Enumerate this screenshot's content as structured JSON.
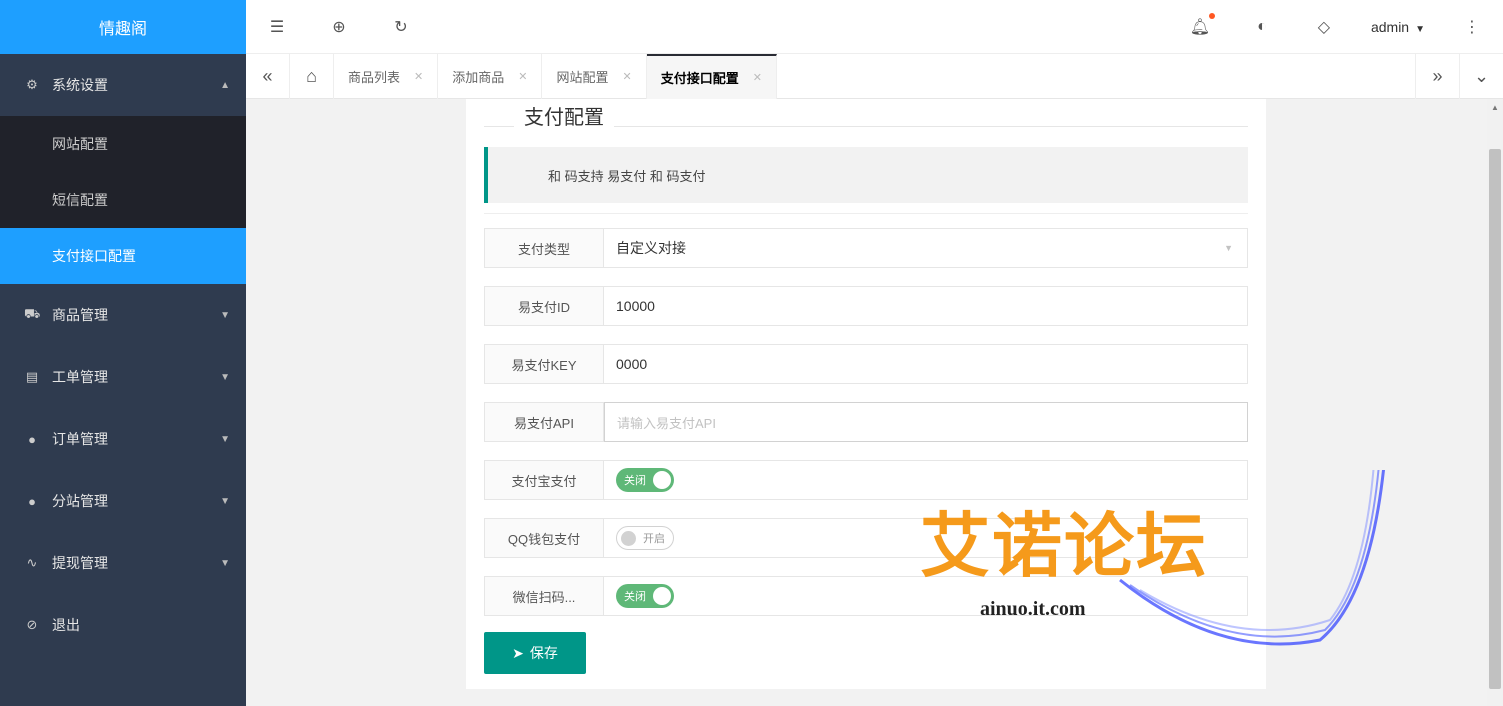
{
  "sidebar": {
    "logo": "情趣阁",
    "menus": [
      {
        "icon": "gear-icon",
        "glyph": "⚙",
        "label": "系统设置",
        "open": true,
        "children": [
          "网站配置",
          "短信配置",
          "支付接口配置"
        ]
      },
      {
        "icon": "cart-icon",
        "glyph": "🛒",
        "label": "商品管理"
      },
      {
        "icon": "ticket-icon",
        "glyph": "▤",
        "label": "工单管理"
      },
      {
        "icon": "order-icon",
        "glyph": "●",
        "label": "订单管理"
      },
      {
        "icon": "site-icon",
        "glyph": "●",
        "label": "分站管理"
      },
      {
        "icon": "withdraw-icon",
        "glyph": "⌇",
        "label": "提现管理"
      },
      {
        "icon": "logout-icon",
        "glyph": "⊘",
        "label": "退出"
      }
    ],
    "active_child": "支付接口配置"
  },
  "header": {
    "user": "admin"
  },
  "tabs": {
    "items": [
      {
        "label": "商品列表"
      },
      {
        "label": "添加商品"
      },
      {
        "label": "网站配置"
      },
      {
        "label": "支付接口配置",
        "active": true
      }
    ]
  },
  "form": {
    "legend": "支付配置",
    "notice": "和 码支持 易支付 和 码支付",
    "pay_type_label": "支付类型",
    "pay_type_value": "自定义对接",
    "epay_id_label": "易支付ID",
    "epay_id_value": "10000",
    "epay_key_label": "易支付KEY",
    "epay_key_value": "0000",
    "epay_api_label": "易支付API",
    "epay_api_placeholder": "请输入易支付API",
    "alipay_label": "支付宝支付",
    "alipay_switch": "关闭",
    "qq_label": "QQ钱包支付",
    "qq_switch": "开启",
    "wechat_label": "微信扫码...",
    "wechat_switch": "关闭",
    "save_label": "保存"
  },
  "watermark": {
    "text": "艾诺论坛",
    "url": "ainuo.it.com"
  },
  "colors": {
    "accent": "#1e9fff",
    "sidebar": "#2f3b4f",
    "primary_button": "#009688",
    "switch_on": "#5fb878"
  }
}
